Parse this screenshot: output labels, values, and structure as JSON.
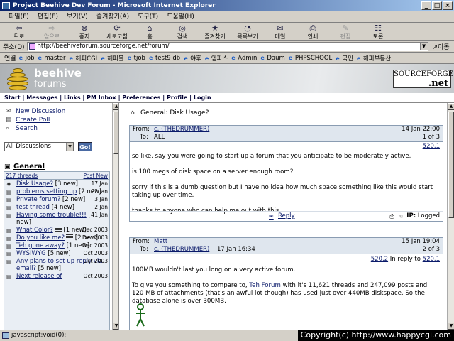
{
  "window": {
    "title": "Project Beehive Dev Forum - Microsoft Internet Explorer",
    "min_label": "_",
    "max_label": "□",
    "close_label": "×"
  },
  "menu": [
    "파일(F)",
    "편집(E)",
    "보기(V)",
    "즐겨찾기(A)",
    "도구(T)",
    "도움말(H)"
  ],
  "toolbar": [
    {
      "label": "뒤로",
      "icon": "back-arrow-icon",
      "glyph": "⇦",
      "enabled": true
    },
    {
      "label": "앞으로",
      "icon": "forward-arrow-icon",
      "glyph": "⇨",
      "enabled": false
    },
    {
      "label": "중지",
      "icon": "stop-icon",
      "glyph": "⊗",
      "enabled": true
    },
    {
      "label": "새로고침",
      "icon": "refresh-icon",
      "glyph": "⟳",
      "enabled": true
    },
    {
      "label": "홈",
      "icon": "home-icon",
      "glyph": "⌂",
      "enabled": true
    },
    {
      "label": "검색",
      "icon": "search-icon",
      "glyph": "◎",
      "enabled": true
    },
    {
      "label": "즐겨찾기",
      "icon": "favorites-icon",
      "glyph": "★",
      "enabled": true
    },
    {
      "label": "목록보기",
      "icon": "history-icon",
      "glyph": "◔",
      "enabled": true
    },
    {
      "label": "메일",
      "icon": "mail-icon",
      "glyph": "✉",
      "enabled": true
    },
    {
      "label": "인쇄",
      "icon": "print-icon",
      "glyph": "⎙",
      "enabled": true
    },
    {
      "label": "편집",
      "icon": "edit-icon",
      "glyph": "✎",
      "enabled": false
    },
    {
      "label": "토론",
      "icon": "discuss-icon",
      "glyph": "☷",
      "enabled": true
    }
  ],
  "address": {
    "label": "주소(D)",
    "url": "http://beehiveforum.sourceforge.net/forum/",
    "go_label": "↗이동"
  },
  "links": {
    "label": "연결",
    "items": [
      "job",
      "master",
      "해피CGI",
      "해피몰",
      "tjob",
      "test9 db",
      "야후",
      "엠파스",
      "Admin",
      "Daum",
      "PHPSCHOOL",
      "국민",
      "해피부동산"
    ]
  },
  "banner": {
    "name": "beehive",
    "sub": "forums",
    "sf_top": "SOURCEFORGE",
    "sf_net": ".net"
  },
  "nav": [
    "Start",
    "Messages",
    "Links",
    "PM Inbox",
    "Preferences",
    "Profile",
    "Login"
  ],
  "nav_sep": " | ",
  "sidebar": {
    "actions": [
      {
        "label": "New Discussion",
        "icon": "new-discussion-icon",
        "glyph": "✉"
      },
      {
        "label": "Create Poll",
        "icon": "poll-icon",
        "glyph": "▤"
      },
      {
        "label": "Search",
        "icon": "search-icon",
        "glyph": "⌕"
      }
    ],
    "filter_value": "All Discussions",
    "go_label": "Go!",
    "category": "General",
    "threads_count": "217 threads",
    "post_new_label": "Post New",
    "threads": [
      {
        "title": "Disk Usage?",
        "new": "[3 new]",
        "date": "17 Jan",
        "icon": "thread-active-icon",
        "extra_icon": false
      },
      {
        "title": "problems setting up",
        "new": "[2 new]",
        "date": "22 Jan",
        "icon": "thread-unread-icon",
        "extra_icon": false
      },
      {
        "title": "Private forum?",
        "new": "[2 new]",
        "date": "3 Jan",
        "icon": "thread-unread-icon",
        "extra_icon": false
      },
      {
        "title": "test thread",
        "new": "[4 new]",
        "date": "2 Jan",
        "icon": "thread-unread-icon",
        "extra_icon": false
      },
      {
        "title": "Having some trouble!!!",
        "new": "[4 new]",
        "date": "1 Jan",
        "icon": "thread-unread-icon",
        "extra_icon": false
      },
      {
        "title": "What Color?",
        "new": "[1 new]",
        "date": "Dec 2003",
        "icon": "thread-unread-icon",
        "extra_icon": true
      },
      {
        "title": "Do you like me?",
        "new": "[2 new]",
        "date": "Dec 2003",
        "icon": "thread-unread-icon",
        "extra_icon": true
      },
      {
        "title": "Teh gone away?",
        "new": "[1 new]",
        "date": "Dec 2003",
        "icon": "thread-unread-icon",
        "extra_icon": false
      },
      {
        "title": "WYSIWYG",
        "new": "[5 new]",
        "date": "Oct 2003",
        "icon": "thread-unread-icon",
        "extra_icon": false
      },
      {
        "title": "Any plans to set up reply via email?",
        "new": "[5 new]",
        "date": "Oct 2003",
        "icon": "thread-unread-icon",
        "extra_icon": false
      },
      {
        "title": "Next release of",
        "new": "",
        "date": "Oct 2003",
        "icon": "thread-unread-icon",
        "extra_icon": false
      }
    ]
  },
  "main": {
    "breadcrumb": "General: Disk Usage?",
    "posts": [
      {
        "from_label": "From:",
        "from": "c. (THEDRUMMER)",
        "to_label": "To:",
        "to": "ALL",
        "to_link": false,
        "to_date": "",
        "datetime": "14 Jan 22:00",
        "position": "1 of 3",
        "msg_link": "520.1",
        "reply_to_label": "",
        "reply_to": "",
        "paragraphs": [
          "so like, say you were going to start up a forum that you anticipate to be moderately active.",
          "is 100 megs of disk space on a server enough room?",
          "sorry if this is a dumb question but I have no idea how much space something like this would start taking up over time.",
          "thanks to anyone who can help me out with this."
        ],
        "reply_label": "Reply",
        "ip_label": "IP:",
        "ip_value": "Logged"
      },
      {
        "from_label": "From:",
        "from": "Matt",
        "to_label": "To:",
        "to": "c. (THEDRUMMER)",
        "to_link": true,
        "to_date": "17 Jan 16:34",
        "datetime": "15 Jan 19:04",
        "position": "2 of 3",
        "msg_link": "520.2",
        "reply_to_label": "In reply to",
        "reply_to": "520.1",
        "intro": "100MB wouldn't last you long on a very active forum.",
        "p2_pre": "To give you something to compare to, ",
        "p2_link": "Teh Forum",
        "p2_post": " with it's 11,621 threads and 247,099 posts and 120 MB of attachments (that's an awful lot though) has used just over 440MB diskspace. So the database alone is over 300MB."
      }
    ]
  },
  "status": "javascript:void(0);",
  "copyright": "Copyright(c) http://www.happycgi.com"
}
